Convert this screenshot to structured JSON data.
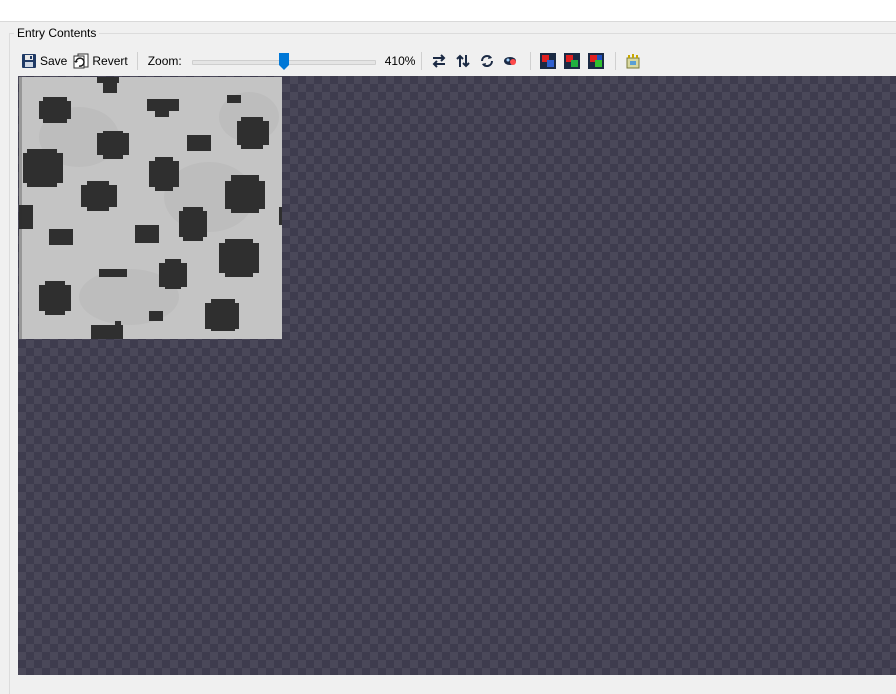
{
  "group": {
    "title": "Entry Contents"
  },
  "toolbar": {
    "save_label": "Save",
    "revert_label": "Revert",
    "zoom_label": "Zoom:",
    "zoom_value": "410%",
    "zoom_slider_fraction": 0.5,
    "icons": [
      "save-icon",
      "revert-icon",
      "flip-horizontal-icon",
      "flip-vertical-icon",
      "rotate-icon",
      "color-remap-icon",
      "red-channel-icon",
      "green-channel-icon",
      "blue-channel-icon",
      "palette-icon"
    ]
  },
  "colors": {
    "canvas_bg": "#4a4859",
    "checker_dark": "#3e3c4e",
    "texture_light": "#c4c4c4",
    "texture_spot": "#2f2f2f"
  }
}
